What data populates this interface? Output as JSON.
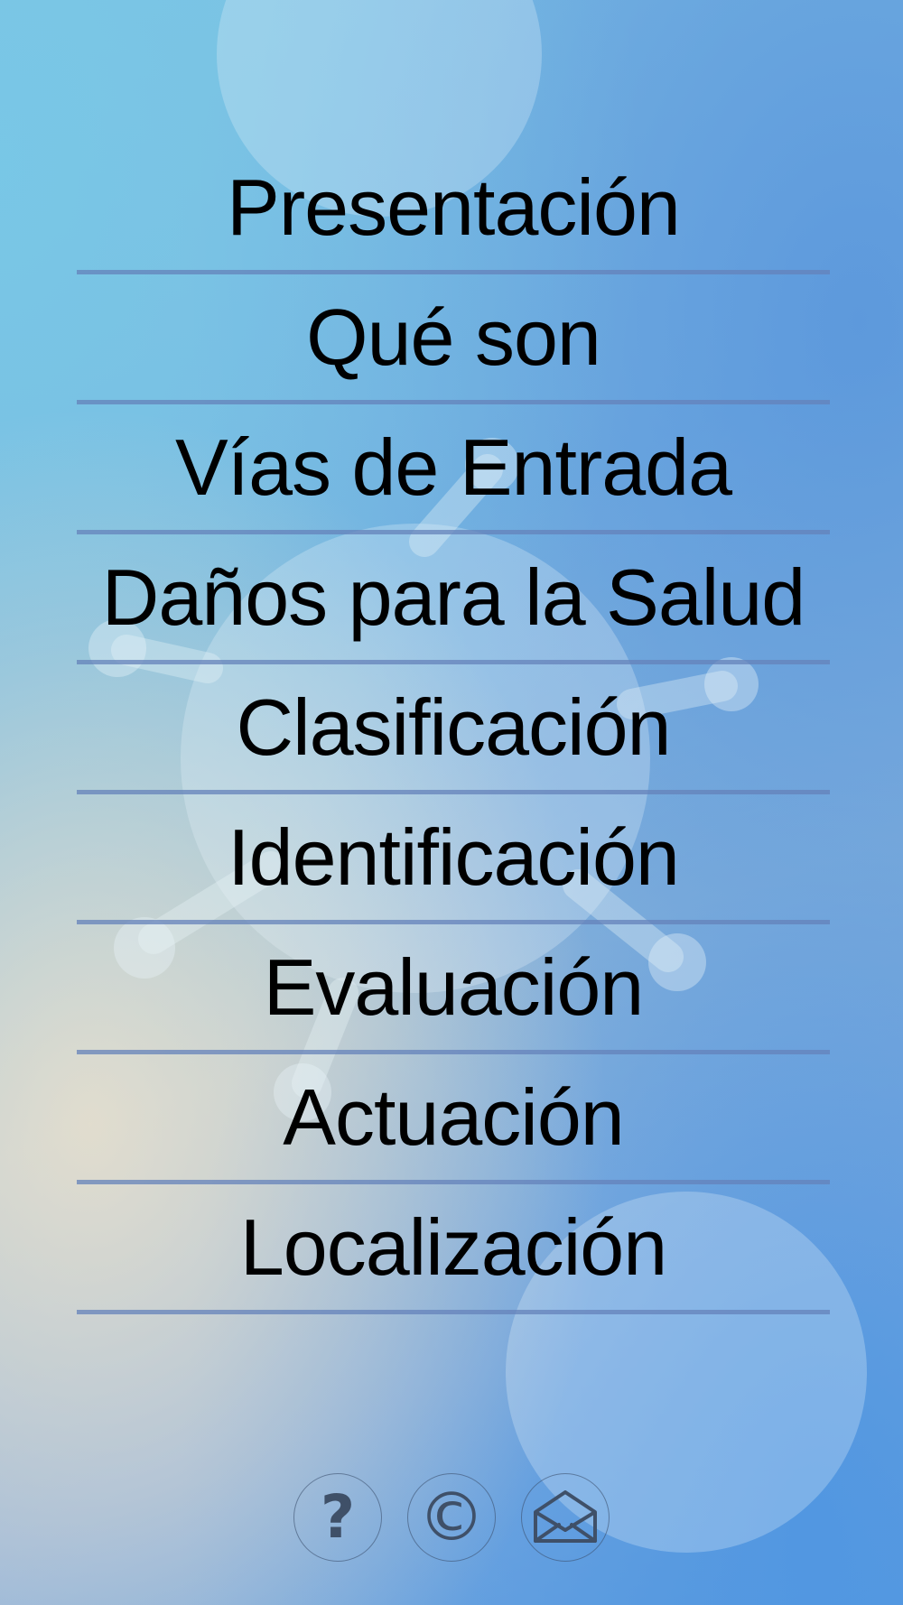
{
  "menu": {
    "items": [
      {
        "label": "Presentación"
      },
      {
        "label": "Qué son"
      },
      {
        "label": "Vías de Entrada"
      },
      {
        "label": "Daños para la Salud"
      },
      {
        "label": "Clasificación"
      },
      {
        "label": "Identificación"
      },
      {
        "label": "Evaluación"
      },
      {
        "label": "Actuación"
      },
      {
        "label": "Localización"
      }
    ]
  },
  "footer": {
    "help_glyph": "?",
    "copyright_glyph": "©",
    "icons": [
      "help-icon",
      "copyright-icon",
      "mail-icon"
    ]
  },
  "colors": {
    "text": "#000000",
    "divider": "#6482b9",
    "icon": "#3f5068"
  }
}
